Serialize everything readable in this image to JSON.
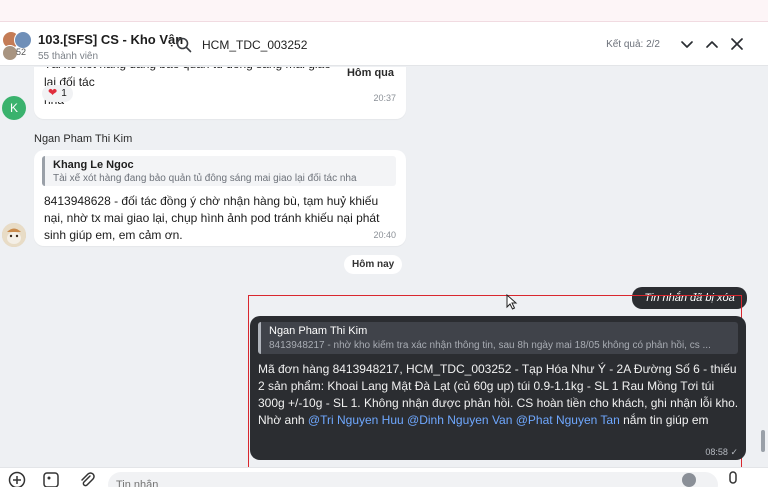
{
  "header": {
    "group_name": "103.[SFS] CS - Kho Vận",
    "member_count": "55 thành viên",
    "avatar_count": "52"
  },
  "search": {
    "value": "HCM_TDC_003252",
    "result_count": "Kết quả: 2/2"
  },
  "messages": {
    "m1": {
      "line1": "Tài xế xót hàng đang bảo quản tủ đông sáng mai giao lại đối tác",
      "line2": "nha",
      "label": "Hôm qua",
      "reaction_count": "1",
      "time": "20:37",
      "avatar_initial": "K"
    },
    "m2": {
      "sender": "Ngan Pham Thi Kim",
      "quote_name": "Khang Le Ngoc",
      "quote_text": "Tài xế xót hàng đang bảo quản tủ đông sáng mai giao lại đối tác nha",
      "text": "8413948628 - đối tác đồng ý chờ nhận hàng bù, tạm huỷ khiếu nại, nhờ tx mai giao lại, chụp hình ảnh pod tránh khiếu nại phát sinh giúp em, em cảm ơn.",
      "time": "20:40"
    },
    "date_separator": "Hôm nay",
    "deleted": "Tin nhắn đã bị xóa",
    "m3": {
      "quote_name": "Ngan Pham Thi Kim",
      "quote_text": "8413948217 - nhờ kho kiểm tra xác nhận thông tin, sau 8h ngày mai 18/05 không có phản hồi, cs ...",
      "text_main": "Mã đơn hàng 8413948217, HCM_TDC_003252 - Tạp Hóa Như Ý - 2A Đường Số 6 - thiếu 2 sản phẩm: Khoai Lang Mật Đà Lạt (củ 60g up) túi 0.9-1.1kg - SL 1 Rau Mồng Tơi túi 300g +/-10g - SL 1. Không nhận được phản hồi. CS hoàn tiền cho khách, ghi nhận lỗi kho. Nhờ anh",
      "mention1": "@Tri Nguyen Huu",
      "mention2": "@Dinh Nguyen Van",
      "mention3": "@Phat Nguyen Tan",
      "text_end": "nắm tin giúp em",
      "time": "08:58",
      "status": "✓"
    }
  },
  "compose": {
    "placeholder": "Tin nhắn"
  },
  "colors": {
    "dark_bubble": "#2b2d31",
    "mention": "#6fa8ff",
    "highlight": "#d9272e",
    "k_avatar": "#3ab26d"
  },
  "icons": [
    "search-icon",
    "chevron-down-icon",
    "chevron-up-icon",
    "close-icon",
    "heart-icon",
    "add-icon",
    "image-icon",
    "attach-icon",
    "mic-icon"
  ]
}
